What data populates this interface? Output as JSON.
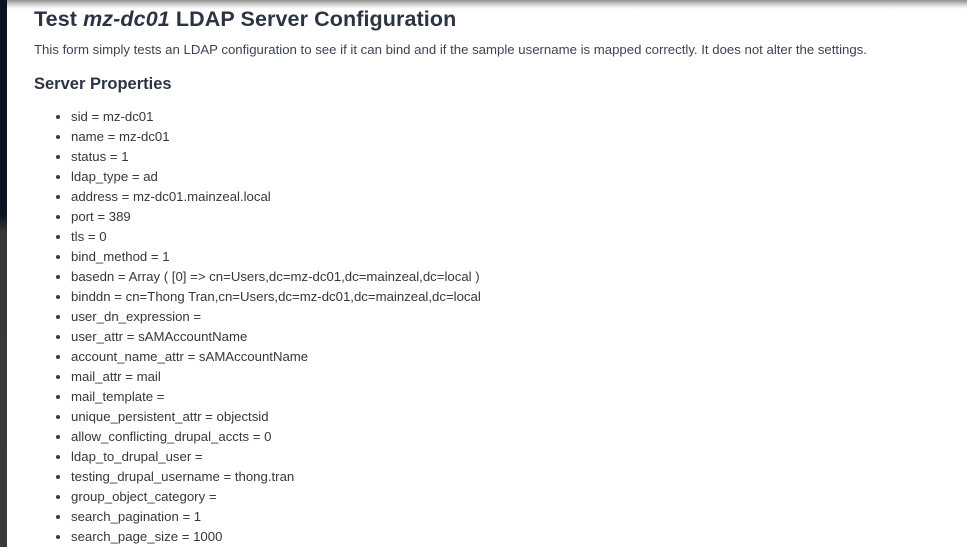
{
  "page": {
    "title_prefix": "Test ",
    "title_server_name": "mz-dc01",
    "title_suffix": " LDAP Server Configuration",
    "intro": "This form simply tests an LDAP configuration to see if it can bind and if the sample username is mapped correctly. It does not alter the settings.",
    "section_heading": "Server Properties"
  },
  "colors": {
    "heading": "#2c3444",
    "body_text": "#33383f",
    "left_strip_top": "#0d1220",
    "left_strip_bottom": "#383838",
    "background": "#ffffff"
  },
  "server_properties": [
    {
      "key": "sid",
      "value": "mz-dc01",
      "text": "sid = mz-dc01"
    },
    {
      "key": "name",
      "value": "mz-dc01",
      "text": "name = mz-dc01"
    },
    {
      "key": "status",
      "value": "1",
      "text": "status = 1"
    },
    {
      "key": "ldap_type",
      "value": "ad",
      "text": "ldap_type = ad"
    },
    {
      "key": "address",
      "value": "mz-dc01.mainzeal.local",
      "text": "address = mz-dc01.mainzeal.local"
    },
    {
      "key": "port",
      "value": "389",
      "text": "port = 389"
    },
    {
      "key": "tls",
      "value": "0",
      "text": "tls = 0"
    },
    {
      "key": "bind_method",
      "value": "1",
      "text": "bind_method = 1"
    },
    {
      "key": "basedn",
      "value": "Array ( [0] => cn=Users,dc=mz-dc01,dc=mainzeal,dc=local )",
      "text": "basedn = Array ( [0] => cn=Users,dc=mz-dc01,dc=mainzeal,dc=local )"
    },
    {
      "key": "binddn",
      "value": "cn=Thong Tran,cn=Users,dc=mz-dc01,dc=mainzeal,dc=local",
      "text": "binddn = cn=Thong Tran,cn=Users,dc=mz-dc01,dc=mainzeal,dc=local"
    },
    {
      "key": "user_dn_expression",
      "value": "",
      "text": "user_dn_expression ="
    },
    {
      "key": "user_attr",
      "value": "sAMAccountName",
      "text": "user_attr = sAMAccountName"
    },
    {
      "key": "account_name_attr",
      "value": "sAMAccountName",
      "text": "account_name_attr = sAMAccountName"
    },
    {
      "key": "mail_attr",
      "value": "mail",
      "text": "mail_attr = mail"
    },
    {
      "key": "mail_template",
      "value": "",
      "text": "mail_template ="
    },
    {
      "key": "unique_persistent_attr",
      "value": "objectsid",
      "text": "unique_persistent_attr = objectsid"
    },
    {
      "key": "allow_conflicting_drupal_accts",
      "value": "0",
      "text": "allow_conflicting_drupal_accts = 0"
    },
    {
      "key": "ldap_to_drupal_user",
      "value": "",
      "text": "ldap_to_drupal_user ="
    },
    {
      "key": "testing_drupal_username",
      "value": "thong.tran",
      "text": "testing_drupal_username = thong.tran"
    },
    {
      "key": "group_object_category",
      "value": "",
      "text": "group_object_category ="
    },
    {
      "key": "search_pagination",
      "value": "1",
      "text": "search_pagination = 1"
    },
    {
      "key": "search_page_size",
      "value": "1000",
      "text": "search_page_size = 1000"
    }
  ]
}
